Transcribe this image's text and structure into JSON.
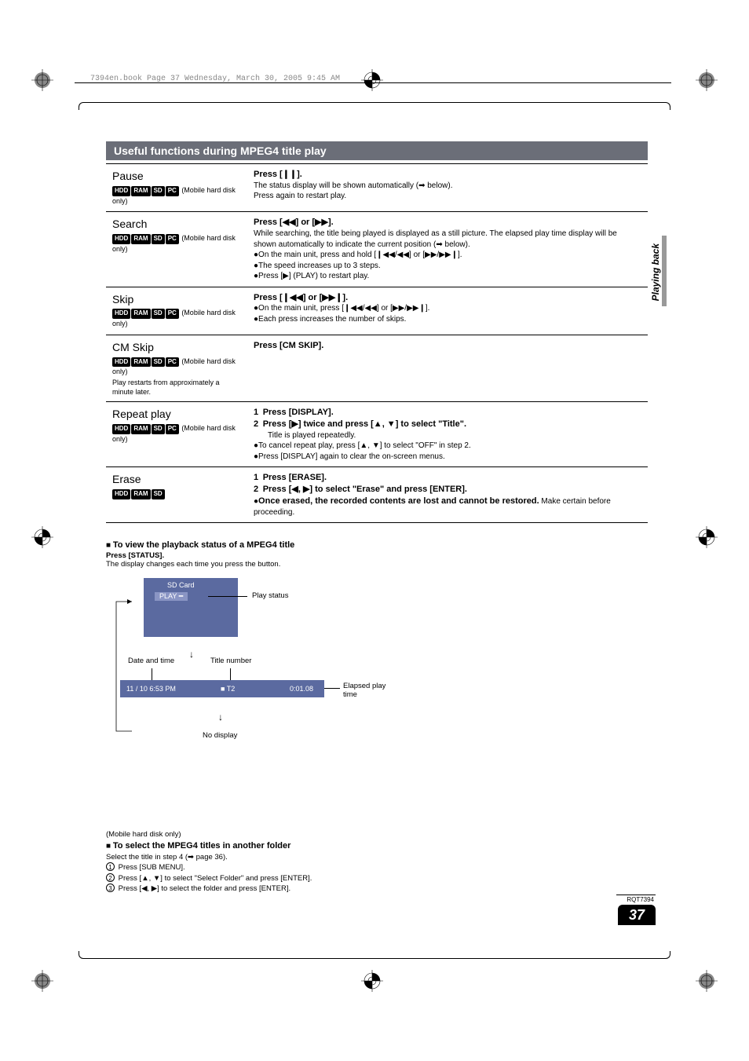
{
  "header_line": "7394en.book  Page 37  Wednesday, March 30, 2005  9:45 AM",
  "section_header": "Useful functions during MPEG4 title play",
  "side_tab": "Playing back",
  "page_number": "37",
  "rqt": "RQT7394",
  "rows": [
    {
      "title": "Pause",
      "tags": [
        "HDD",
        "RAM",
        "SD",
        "PC"
      ],
      "sub": "(Mobile hard disk only)",
      "right_bold": "Press [❙❙].",
      "right_lines": [
        "The status display will be shown automatically (➡ below).",
        "Press again to restart play."
      ]
    },
    {
      "title": "Search",
      "tags": [
        "HDD",
        "RAM",
        "SD",
        "PC"
      ],
      "sub": "(Mobile hard disk only)",
      "right_bold": "Press [◀◀] or [▶▶].",
      "right_lines": [
        "While searching, the title being played is displayed as a still picture. The elapsed play time display will be shown automatically to indicate the current position (➡ below).",
        "●On the main unit, press and hold [❙◀◀/◀◀] or [▶▶/▶▶❙].",
        "●The speed increases up to 3 steps.",
        "●Press [▶] (PLAY) to restart play."
      ]
    },
    {
      "title": "Skip",
      "tags": [
        "HDD",
        "RAM",
        "SD",
        "PC"
      ],
      "sub": "(Mobile hard disk only)",
      "right_bold": "Press [❙◀◀] or [▶▶❙].",
      "right_lines": [
        "●On the main unit, press [❙◀◀/◀◀] or [▶▶/▶▶❙].",
        "●Each press increases the number of skips."
      ]
    },
    {
      "title": "CM Skip",
      "tags": [
        "HDD",
        "RAM",
        "SD",
        "PC"
      ],
      "sub": "(Mobile hard disk only)",
      "sub2": "Play restarts from approximately a minute later.",
      "right_bold": "Press [CM SKIP].",
      "right_lines": []
    },
    {
      "title": "Repeat play",
      "tags": [
        "HDD",
        "RAM",
        "SD",
        "PC"
      ],
      "sub": "(Mobile hard disk only)",
      "right_steps": [
        {
          "n": "1",
          "b": "Press [DISPLAY]."
        },
        {
          "n": "2",
          "b": "Press [▶] twice and press [▲, ▼] to select \"Title\".",
          "plain": "Title is played repeatedly."
        }
      ],
      "right_lines": [
        "●To cancel repeat play, press [▲, ▼] to select \"OFF\" in step 2.",
        "●Press [DISPLAY] again to clear the on-screen menus."
      ]
    },
    {
      "title": "Erase",
      "tags": [
        "HDD",
        "RAM",
        "SD"
      ],
      "right_steps": [
        {
          "n": "1",
          "b": "Press [ERASE]."
        },
        {
          "n": "2",
          "b": "Press [◀, ▶] to select \"Erase\" and press [ENTER]."
        }
      ],
      "right_lines": [
        "●<b>Once erased, the recorded contents are lost and cannot be restored.</b> Make certain before proceeding."
      ]
    }
  ],
  "status": {
    "heading": "To view the playback status of a MPEG4 title",
    "press": "Press [STATUS].",
    "desc": "The display changes each time you press the button.",
    "box1_sd": "SD Card",
    "box1_play": "PLAY",
    "label_play_status": "Play status",
    "label_date": "Date and time",
    "label_title_num": "Title number",
    "box2_date": "11 / 10  6:53 PM",
    "box2_title": "■ T2",
    "box2_elapsed": "0:01.08",
    "label_elapsed": "Elapsed play time",
    "label_nodisplay": "No display"
  },
  "folder": {
    "pre": "(Mobile hard disk only)",
    "heading": "To select the MPEG4 titles in another folder",
    "line1": "Select the title in step 4 (➡ page 36).",
    "steps": [
      "Press [SUB MENU].",
      "Press [▲, ▼] to select \"Select Folder\" and press [ENTER].",
      "Press [◀, ▶] to select the folder and press [ENTER]."
    ]
  }
}
